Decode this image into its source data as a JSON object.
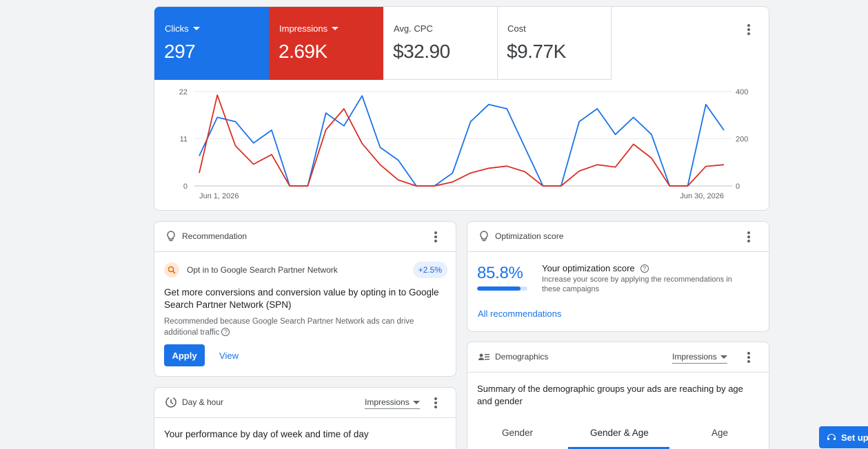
{
  "overview": {
    "metrics": [
      {
        "label": "Clicks",
        "value": "297",
        "color": "#1a73e8",
        "selected": true
      },
      {
        "label": "Impressions",
        "value": "2.69K",
        "color": "#d93025",
        "selected": true
      },
      {
        "label": "Avg. CPC",
        "value": "$32.90"
      },
      {
        "label": "Cost",
        "value": "$9.77K"
      }
    ]
  },
  "chart_data": {
    "type": "line",
    "x_start_label": "Jun 1, 2026",
    "x_end_label": "Jun 30, 2026",
    "left_axis": {
      "ticks": [
        "0",
        "11",
        "22"
      ],
      "ylim": [
        0,
        22
      ]
    },
    "right_axis": {
      "ticks": [
        "0",
        "200",
        "400"
      ],
      "ylim": [
        0,
        400
      ]
    },
    "grid": true,
    "series": [
      {
        "axis": "left",
        "color": "#1a73e8",
        "values": [
          7,
          16,
          15,
          10,
          13,
          0,
          0,
          17,
          14,
          21,
          9,
          6,
          0,
          0,
          3,
          15,
          19,
          18,
          9,
          0,
          0,
          15,
          18,
          12,
          16,
          12,
          0,
          0,
          19,
          13
        ]
      },
      {
        "axis": "right",
        "color": "#d93025",
        "values": [
          55,
          385,
          170,
          92,
          133,
          0,
          0,
          238,
          327,
          180,
          90,
          25,
          0,
          0,
          17,
          55,
          75,
          84,
          60,
          0,
          0,
          63,
          90,
          80,
          177,
          118,
          0,
          0,
          83,
          90
        ]
      }
    ]
  },
  "recommendation": {
    "title": "Recommendation",
    "item_title": "Opt in to Google Search Partner Network",
    "badge": "+2.5%",
    "headline": "Get more conversions and conversion value by opting in to Google Search Partner Network (SPN)",
    "reason": "Recommended because Google Search Partner Network ads can drive additional traffic",
    "apply_label": "Apply",
    "view_label": "View"
  },
  "optimization": {
    "title": "Optimization score",
    "score": "85.8%",
    "score_fraction": 0.858,
    "score_title": "Your optimization score",
    "score_desc": "Increase your score by applying the recommendations in these campaigns",
    "link": "All recommendations"
  },
  "demographics": {
    "title": "Demographics",
    "selector": "Impressions",
    "desc": "Summary of the demographic groups your ads are reaching by age and gender",
    "tabs": [
      "Gender",
      "Gender & Age",
      "Age"
    ],
    "active_tab": "Gender & Age"
  },
  "dayhour": {
    "title": "Day & hour",
    "selector": "Impressions",
    "desc": "Your performance by day of week and time of day"
  },
  "setup": {
    "label": "Set up"
  }
}
